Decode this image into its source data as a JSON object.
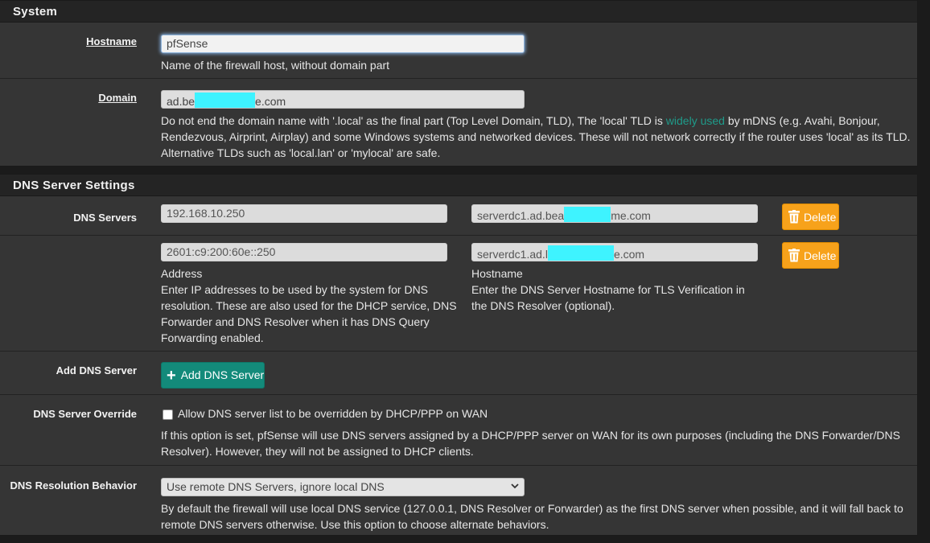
{
  "system": {
    "title": "System",
    "hostname": {
      "label": "Hostname",
      "value": "pfSense",
      "help": "Name of the firewall host, without domain part"
    },
    "domain": {
      "label": "Domain",
      "value_prefix": "ad.be",
      "value_suffix": "e.com",
      "help_before_link": "Do not end the domain name with '.local' as the final part (Top Level Domain, TLD), The 'local' TLD is ",
      "help_link": "widely used",
      "help_after_link": " by mDNS (e.g. Avahi, Bonjour, Rendezvous, Airprint, Airplay) and some Windows systems and networked devices. These will not network correctly if the router uses 'local' as its TLD. Alternative TLDs such as 'local.lan' or 'mylocal' are safe."
    }
  },
  "dns": {
    "title": "DNS Server Settings",
    "servers_label": "DNS Servers",
    "servers": [
      {
        "address": "192.168.10.250",
        "host_prefix": "serverdc1.ad.bea",
        "host_suffix": "me.com",
        "delete_label": "Delete"
      },
      {
        "address": "2601:c9:200:60e::250",
        "host_prefix": "serverdc1.ad.l",
        "host_suffix": "e.com",
        "delete_label": "Delete"
      }
    ],
    "address_caption": "Address",
    "address_help": "Enter IP addresses to be used by the system for DNS resolution. These are also used for the DHCP service, DNS Forwarder and DNS Resolver when it has DNS Query Forwarding enabled.",
    "hostname_caption": "Hostname",
    "hostname_help": "Enter the DNS Server Hostname for TLS Verification in the DNS Resolver (optional).",
    "add_label": "Add DNS Server",
    "add_button": "Add DNS Server",
    "override": {
      "label": "DNS Server Override",
      "checkbox_label": "Allow DNS server list to be overridden by DHCP/PPP on WAN",
      "checked": false,
      "help": "If this option is set, pfSense will use DNS servers assigned by a DHCP/PPP server on WAN for its own purposes (including the DNS Forwarder/DNS Resolver). However, they will not be assigned to DHCP clients."
    },
    "resolution": {
      "label": "DNS Resolution Behavior",
      "selected": "Use remote DNS Servers, ignore local DNS",
      "help": "By default the firewall will use local DNS service (127.0.0.1, DNS Resolver or Forwarder) as the first DNS server when possible, and it will fall back to remote DNS servers otherwise. Use this option to choose alternate behaviors."
    }
  },
  "colors": {
    "accent": "#138a7a",
    "warning": "#f7a21b",
    "redaction": "#3ef3ff"
  }
}
